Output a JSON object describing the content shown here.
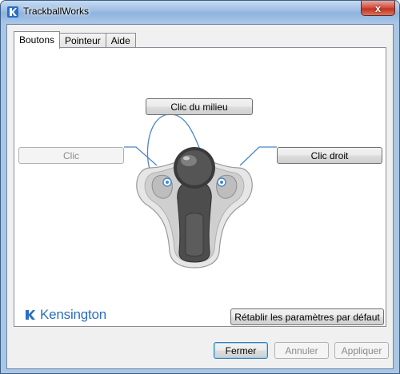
{
  "window": {
    "title": "TrackballWorks",
    "close_glyph": "x",
    "app_icon": "kensington-logo-icon"
  },
  "tabs": [
    {
      "label": "Boutons",
      "active": true
    },
    {
      "label": "Pointeur",
      "active": false
    },
    {
      "label": "Aide",
      "active": false
    }
  ],
  "buttons_panel": {
    "middle_click": "Clic du milieu",
    "left_click": "Clic",
    "right_click": "Clic droit",
    "reset": "Rétablir les paramètres par défaut"
  },
  "brand": {
    "name": "Kensington",
    "color": "#2a6fc0",
    "icon": "kensington-logo-icon"
  },
  "footer": {
    "close": "Fermer",
    "cancel": "Annuler",
    "apply": "Appliquer"
  },
  "colors": {
    "connector_line": "#4a86c8",
    "device_body": "#4d4d4d",
    "device_shell": "#cfcfcf"
  }
}
